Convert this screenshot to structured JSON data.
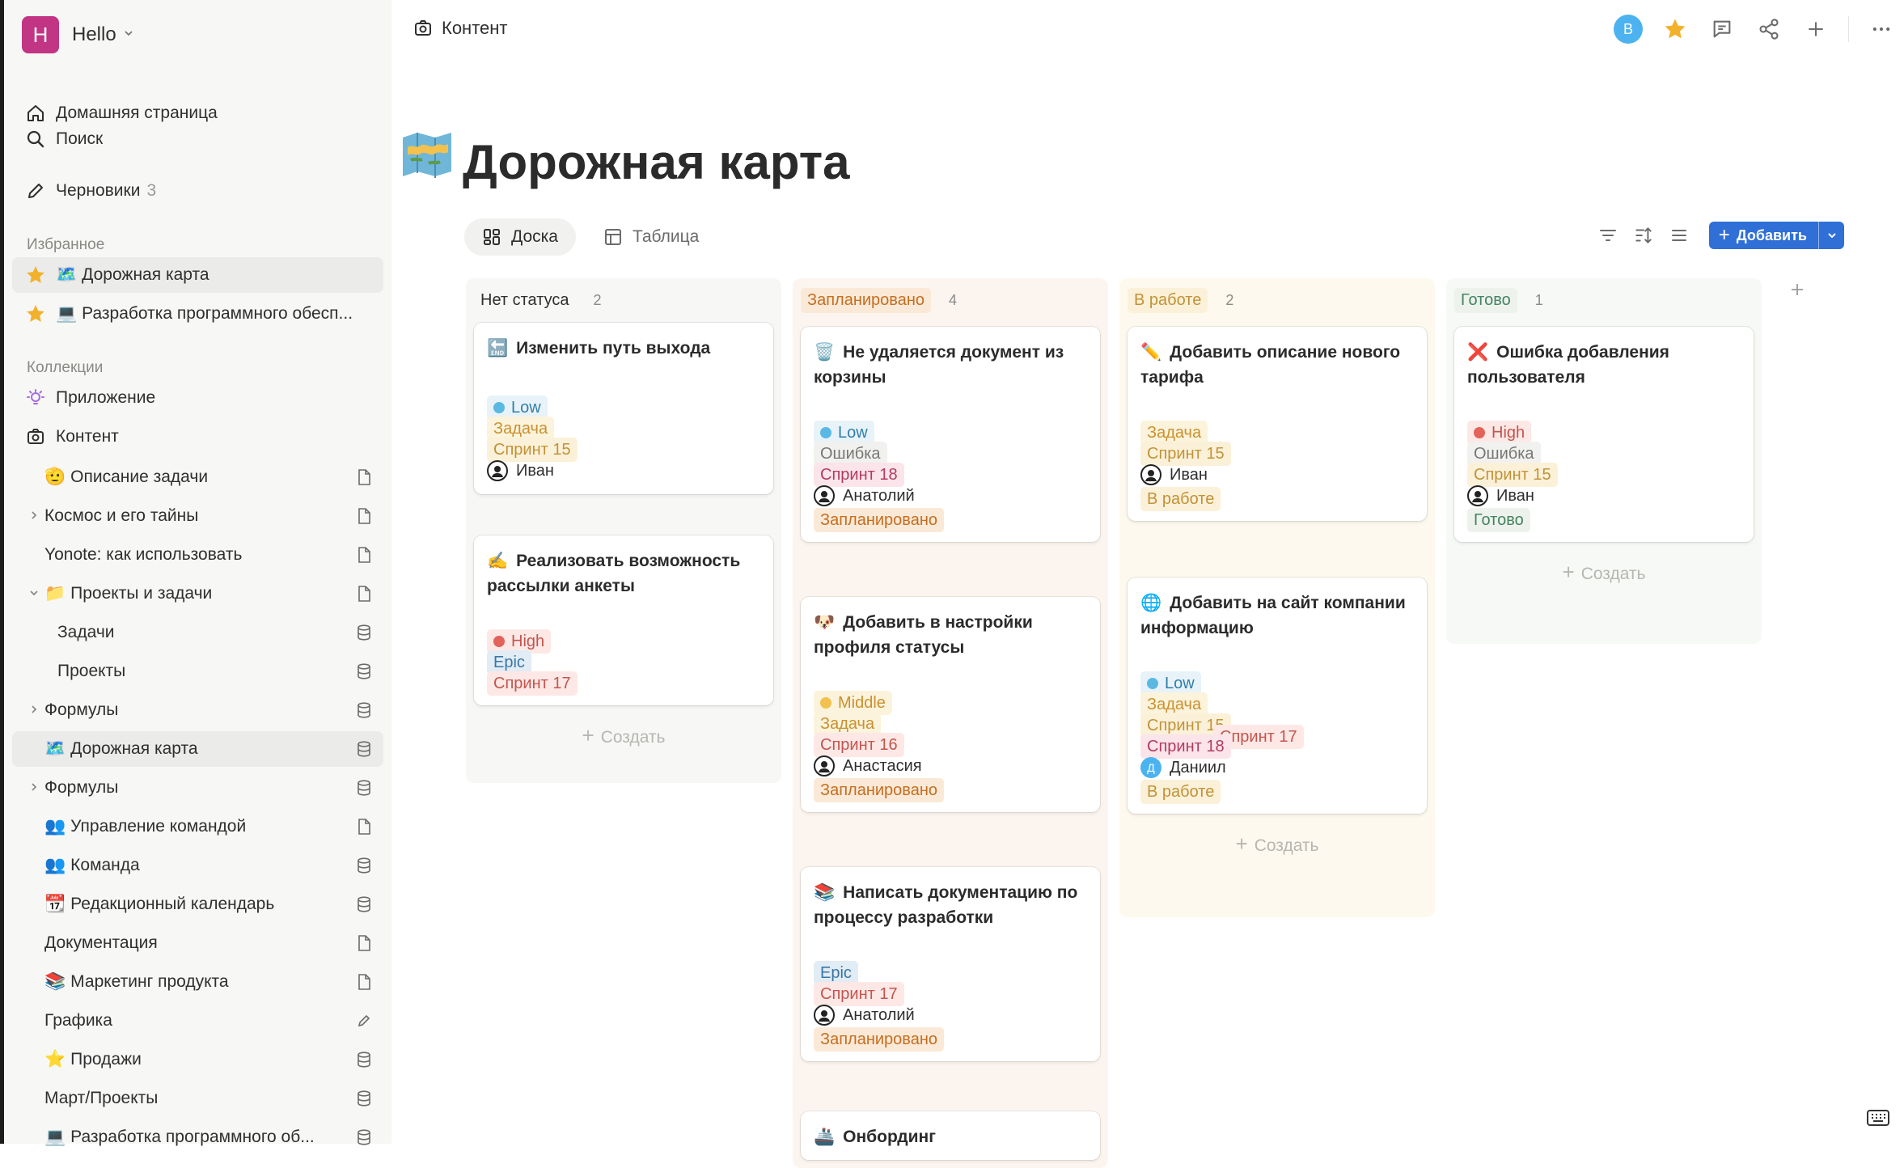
{
  "workspace": {
    "initial": "H",
    "name": "Hello",
    "color": "#c13584"
  },
  "nav": [
    {
      "label": "Домашняя страница",
      "icon": "home-icon"
    },
    {
      "label": "Поиск",
      "icon": "search-icon"
    },
    {
      "label": "Черновики",
      "count": "3",
      "icon": "pencil-icon"
    }
  ],
  "favorites": {
    "title": "Избранное",
    "items": [
      {
        "emoji": "🗺️",
        "label": "Дорожная карта"
      },
      {
        "emoji": "💻",
        "label": "Разработка программного обесп..."
      }
    ]
  },
  "collections": {
    "title": "Коллекции",
    "items": [
      {
        "label": "Приложение",
        "icon": "lightbulb-icon"
      },
      {
        "label": "Контент",
        "icon": "camera-icon"
      }
    ]
  },
  "tree": [
    {
      "emoji": "🫡",
      "label": "Описание задачи",
      "end": "doc",
      "indent": 1,
      "chev": false
    },
    {
      "emoji": "",
      "label": "Космос и его тайны",
      "end": "doc",
      "indent": 1,
      "chev": "right"
    },
    {
      "emoji": "",
      "label": "Yonote: как использовать",
      "end": "doc",
      "indent": 1,
      "chev": false
    },
    {
      "emoji": "📁",
      "label": "Проекты и задачи",
      "end": "doc",
      "indent": 1,
      "chev": "down"
    },
    {
      "emoji": "",
      "label": "Задачи",
      "end": "db",
      "indent": 2,
      "chev": false
    },
    {
      "emoji": "",
      "label": "Проекты",
      "end": "db",
      "indent": 2,
      "chev": false
    },
    {
      "emoji": "",
      "label": "Формулы",
      "end": "db",
      "indent": 1,
      "chev": "right"
    },
    {
      "emoji": "🗺️",
      "label": "Дорожная карта",
      "end": "db",
      "indent": 1,
      "chev": false,
      "active": true
    },
    {
      "emoji": "",
      "label": "Формулы",
      "end": "db",
      "indent": 1,
      "chev": "right"
    },
    {
      "emoji": "👥",
      "label": "Управление командой",
      "end": "doc",
      "indent": 1,
      "chev": false
    },
    {
      "emoji": "👥",
      "label": "Команда",
      "end": "db",
      "indent": 1,
      "chev": false
    },
    {
      "emoji": "📆",
      "label": "Редакционный календарь",
      "end": "db",
      "indent": 1,
      "chev": false
    },
    {
      "emoji": "",
      "label": "Документация",
      "end": "doc",
      "indent": 1,
      "chev": false
    },
    {
      "emoji": "📚",
      "label": "Маркетинг продукта",
      "end": "doc",
      "indent": 1,
      "chev": false
    },
    {
      "emoji": "",
      "label": "Графика",
      "end": "pen",
      "indent": 1,
      "chev": false
    },
    {
      "emoji": "⭐",
      "label": "Продажи",
      "end": "db",
      "indent": 1,
      "chev": false
    },
    {
      "emoji": "",
      "label": "Март/Проекты",
      "end": "db",
      "indent": 1,
      "chev": false
    },
    {
      "emoji": "💻",
      "label": "Разработка программного об...",
      "end": "db",
      "indent": 1,
      "chev": false
    }
  ],
  "header": {
    "breadcrumb": "Контент",
    "user_initial": "В"
  },
  "page": {
    "emoji": "🗺️",
    "title": "Дорожная карта"
  },
  "views": [
    {
      "label": "Доска",
      "active": true,
      "icon": "board-icon"
    },
    {
      "label": "Таблица",
      "active": false,
      "icon": "table-icon"
    }
  ],
  "add_button": "Добавить",
  "create_label": "Создать",
  "columns": [
    {
      "name": "Нет статуса",
      "count": "2",
      "bg": "#f7f7f5",
      "tag": "",
      "cards": [
        {
          "emoji": "🔚",
          "title": "Изменить путь выхода",
          "tags": [
            {
              "t": "Low",
              "c": "t-blue",
              "dot": "#5bb8e3"
            },
            {
              "t": "Задача",
              "c": "t-yellow"
            },
            {
              "t": "Спринт 15",
              "c": "t-gold"
            }
          ],
          "person": {
            "name": "Иван",
            "av": "#222"
          },
          "status": null
        },
        {
          "emoji": "✍️",
          "title": "Реализовать возможность рассылки анкеты",
          "tags": [
            {
              "t": "High",
              "c": "t-red",
              "dot": "#e3625a"
            },
            {
              "t": "Epic",
              "c": "t-epic"
            },
            {
              "t": "Спринт 17",
              "c": "t-red"
            }
          ],
          "person": null,
          "status": null
        }
      ]
    },
    {
      "name": "Запланировано",
      "count": "4",
      "bg": "#fcf5ef",
      "tag": "t-orange",
      "cards": [
        {
          "emoji": "🗑️",
          "title": "Не удаляется документ из корзины",
          "tags": [
            {
              "t": "Low",
              "c": "t-blue",
              "dot": "#5bb8e3"
            },
            {
              "t": "Ошибка",
              "c": "t-gray"
            },
            {
              "t": "Спринт 18",
              "c": "t-pink"
            }
          ],
          "person": {
            "name": "Анатолий",
            "av": "#222"
          },
          "status": {
            "t": "Запланировано",
            "c": "t-orange"
          }
        },
        {
          "emoji": "🐶",
          "title": "Добавить в настройки профиля статусы",
          "tags": [
            {
              "t": "Middle",
              "c": "t-yellow",
              "dot": "#f2c14e"
            },
            {
              "t": "Задача",
              "c": "t-yellow"
            },
            {
              "t": "Спринт 16",
              "c": "t-red"
            }
          ],
          "person": {
            "name": "Анастасия",
            "av": "#222"
          },
          "status": {
            "t": "Запланировано",
            "c": "t-orange"
          }
        },
        {
          "emoji": "📚",
          "title": "Написать документацию по процессу разработки",
          "tags": [
            {
              "t": "Epic",
              "c": "t-epic"
            },
            {
              "t": "Спринт 17",
              "c": "t-red"
            }
          ],
          "person": {
            "name": "Анатолий",
            "av": "#222"
          },
          "status": {
            "t": "Запланировано",
            "c": "t-orange"
          }
        },
        {
          "emoji": "🚢",
          "title": "Онбординг",
          "tags": [],
          "person": null,
          "status": null
        }
      ]
    },
    {
      "name": "В работе",
      "count": "2",
      "bg": "#fdf9ee",
      "tag": "t-gold",
      "cards": [
        {
          "emoji": "✏️",
          "title": "Добавить описание нового тарифа",
          "tags": [
            {
              "t": "Задача",
              "c": "t-yellow"
            },
            {
              "t": "Спринт 15",
              "c": "t-gold"
            }
          ],
          "person": {
            "name": "Иван",
            "av": "#222"
          },
          "status": {
            "t": "В работе",
            "c": "t-gold"
          }
        },
        {
          "emoji": "🌐",
          "title": "Добавить на сайт компании информацию",
          "tags": [
            {
              "t": "Low",
              "c": "t-blue",
              "dot": "#5bb8e3"
            },
            {
              "t": "Задача",
              "c": "t-yellow"
            },
            {
              "t": "Спринт 15",
              "c": "t-gold"
            },
            {
              "t": "Спринт 17",
              "c": "t-red"
            },
            {
              "t": "Спринт 18",
              "c": "t-pink"
            }
          ],
          "person": {
            "name": "Даниил",
            "av": "#4cb3f0",
            "initial": "Д"
          },
          "status": {
            "t": "В работе",
            "c": "t-gold"
          }
        }
      ]
    },
    {
      "name": "Готово",
      "count": "1",
      "bg": "#f6f9f5",
      "tag": "t-green",
      "cards": [
        {
          "emoji": "❌",
          "title": "Ошибка добавления пользователя",
          "tags": [
            {
              "t": "High",
              "c": "t-red",
              "dot": "#e3625a"
            },
            {
              "t": "Ошибка",
              "c": "t-gray"
            },
            {
              "t": "Спринт 15",
              "c": "t-gold"
            }
          ],
          "person": {
            "name": "Иван",
            "av": "#222"
          },
          "status": {
            "t": "Готово",
            "c": "t-green"
          }
        }
      ]
    }
  ]
}
